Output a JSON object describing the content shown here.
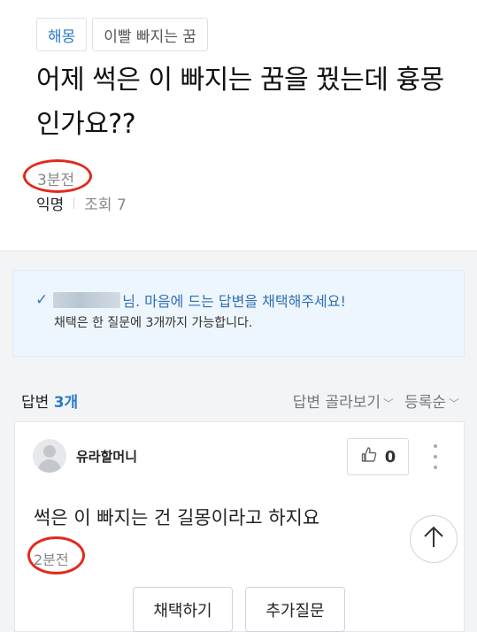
{
  "question": {
    "tags": [
      "해몽",
      "이빨 빠지는 꿈"
    ],
    "title": "어제 썩은 이 빠지는 꿈을 꿨는데 흉몽인가요??",
    "time": "3분전",
    "author": "익명",
    "views": "조회 7"
  },
  "notice": {
    "line1_suffix": "님. 마음에 드는 답변을 채택해주세요!",
    "line2": "채택은 한 질문에 3개까지 가능합니다."
  },
  "answers_header": {
    "label": "답변",
    "count": "3개",
    "filter": "답변 골라보기",
    "sort": "등록순"
  },
  "answer": {
    "author": "유라할머니",
    "likes": "0",
    "text": "썩은 이 빠지는 건 길몽이라고 하지요",
    "time": "2분전",
    "adopt_label": "채택하기",
    "followup_label": "추가질문"
  },
  "icons": {
    "check": "check-icon",
    "thumb": "thumbs-up-icon",
    "more": "more-vertical-icon",
    "top": "arrow-up-icon"
  },
  "colors": {
    "accent": "#2b79c8",
    "highlight_circle": "#e3291b"
  }
}
